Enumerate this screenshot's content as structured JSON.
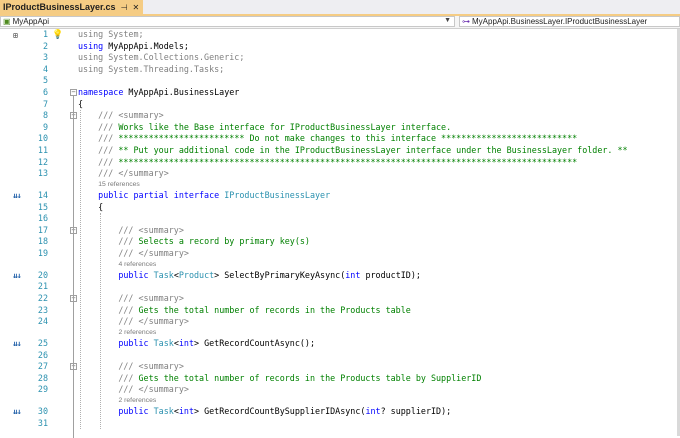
{
  "tab": {
    "title": "IProductBusinessLayer.cs",
    "pin_icon": "pin-icon",
    "close_icon": "close-icon"
  },
  "nav": {
    "left": "MyAppApi",
    "right": "MyAppApi.BusinessLayer.IProductBusinessLayer"
  },
  "lines": [
    {
      "n": "1",
      "t": [
        [
          "dim",
          "using System;"
        ]
      ]
    },
    {
      "n": "2",
      "t": [
        [
          "kw",
          "using "
        ],
        [
          "",
          "MyAppApi.Models;"
        ]
      ]
    },
    {
      "n": "3",
      "t": [
        [
          "dim",
          "using System.Collections.Generic;"
        ]
      ]
    },
    {
      "n": "4",
      "t": [
        [
          "dim",
          "using System.Threading.Tasks;"
        ]
      ]
    },
    {
      "n": "5",
      "t": []
    },
    {
      "n": "6",
      "t": [
        [
          "kw",
          "namespace "
        ],
        [
          "",
          "MyAppApi.BusinessLayer"
        ]
      ]
    },
    {
      "n": "7",
      "t": [
        [
          "",
          "{"
        ]
      ]
    },
    {
      "n": "8",
      "t": [
        [
          "xd",
          "    /// <summary>"
        ]
      ]
    },
    {
      "n": "9",
      "t": [
        [
          "xd",
          "    /// "
        ],
        [
          "cm",
          "Works like the Base interface for IProductBusinessLayer interface."
        ]
      ]
    },
    {
      "n": "10",
      "t": [
        [
          "xd",
          "    /// "
        ],
        [
          "cm",
          "************************* Do not make changes to this interface ***************************"
        ]
      ]
    },
    {
      "n": "11",
      "t": [
        [
          "xd",
          "    /// "
        ],
        [
          "cm",
          "** Put your additional code in the IProductBusinessLayer interface under the BusinessLayer folder. **"
        ]
      ]
    },
    {
      "n": "12",
      "t": [
        [
          "xd",
          "    /// "
        ],
        [
          "cm",
          "*******************************************************************************************"
        ]
      ]
    },
    {
      "n": "13",
      "t": [
        [
          "xd",
          "    /// </summary>"
        ]
      ],
      "refs": "15 references"
    },
    {
      "n": "14",
      "t": [
        [
          "kw",
          "    public partial interface "
        ],
        [
          "ty",
          "IProductBusinessLayer"
        ]
      ]
    },
    {
      "n": "15",
      "t": [
        [
          "",
          "    {"
        ]
      ]
    },
    {
      "n": "16",
      "t": []
    },
    {
      "n": "17",
      "t": [
        [
          "xd",
          "        /// <summary>"
        ]
      ]
    },
    {
      "n": "18",
      "t": [
        [
          "xd",
          "        /// "
        ],
        [
          "cm",
          "Selects a record by primary key(s)"
        ]
      ]
    },
    {
      "n": "19",
      "t": [
        [
          "xd",
          "        /// </summary>"
        ]
      ],
      "refs": "4 references"
    },
    {
      "n": "20",
      "t": [
        [
          "kw",
          "        public "
        ],
        [
          "ty",
          "Task"
        ],
        [
          "",
          "<"
        ],
        [
          "ty",
          "Product"
        ],
        [
          "",
          "> SelectByPrimaryKeyAsync("
        ],
        [
          "kw",
          "int"
        ],
        [
          "",
          " productID);"
        ]
      ]
    },
    {
      "n": "21",
      "t": []
    },
    {
      "n": "22",
      "t": [
        [
          "xd",
          "        /// <summary>"
        ]
      ]
    },
    {
      "n": "23",
      "t": [
        [
          "xd",
          "        /// "
        ],
        [
          "cm",
          "Gets the total number of records in the Products table"
        ]
      ]
    },
    {
      "n": "24",
      "t": [
        [
          "xd",
          "        /// </summary>"
        ]
      ],
      "refs": "2 references"
    },
    {
      "n": "25",
      "t": [
        [
          "kw",
          "        public "
        ],
        [
          "ty",
          "Task"
        ],
        [
          "",
          "<"
        ],
        [
          "kw",
          "int"
        ],
        [
          "",
          "> GetRecordCountAsync();"
        ]
      ]
    },
    {
      "n": "26",
      "t": []
    },
    {
      "n": "27",
      "t": [
        [
          "xd",
          "        /// <summary>"
        ]
      ]
    },
    {
      "n": "28",
      "t": [
        [
          "xd",
          "        /// "
        ],
        [
          "cm",
          "Gets the total number of records in the Products table by SupplierID"
        ]
      ]
    },
    {
      "n": "29",
      "t": [
        [
          "xd",
          "        /// </summary>"
        ]
      ],
      "refs": "2 references"
    },
    {
      "n": "30",
      "t": [
        [
          "kw",
          "        public "
        ],
        [
          "ty",
          "Task"
        ],
        [
          "",
          "<"
        ],
        [
          "kw",
          "int"
        ],
        [
          "",
          "> GetRecordCountBySupplierIDAsync("
        ],
        [
          "kw",
          "int"
        ],
        [
          "",
          "? supplierID);"
        ]
      ]
    },
    {
      "n": "31",
      "t": []
    }
  ],
  "colors": {
    "keyword": "#0000ff",
    "type": "#2b91af",
    "comment": "#008000",
    "xmldoc": "#808080",
    "line_number": "#2b91af",
    "tab_active": "#f5cc84"
  },
  "gutter_icons": {
    "implementation": "implementation-icon",
    "lightbulb": "lightbulb-icon"
  }
}
